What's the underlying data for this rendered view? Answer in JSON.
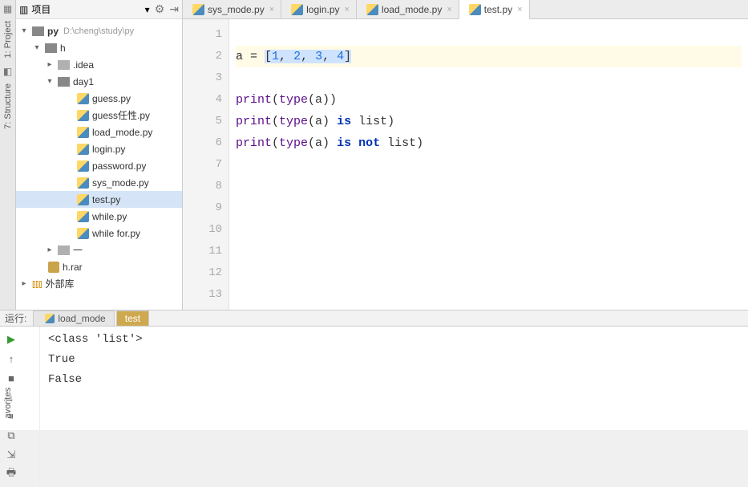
{
  "side_tabs": {
    "project": "1: Project",
    "structure": "7: Structure",
    "favorites": "avorites"
  },
  "project_panel": {
    "header": {
      "title": "项目"
    },
    "root": {
      "name": "py",
      "path": "D:\\cheng\\study\\py"
    },
    "h_folder": "h",
    "idea_folder": ".idea",
    "day1_folder": "day1",
    "files": {
      "guess": "guess.py",
      "guess2": "guess任性.py",
      "load_mode": "load_mode.py",
      "login": "login.py",
      "password": "password.py",
      "sys_mode": "sys_mode.py",
      "test": "test.py",
      "while": "while.py",
      "while_for": "while for.py"
    },
    "dash_folder": "一",
    "hrar": "h.rar",
    "external": "外部库"
  },
  "tabs": {
    "sys_mode": "sys_mode.py",
    "login": "login.py",
    "load_mode": "load_mode.py",
    "test": "test.py"
  },
  "code": {
    "line2a": "a = ",
    "line2b": "[",
    "line2v1": "1",
    "line2v2": "2",
    "line2v3": "3",
    "line2v4": "4",
    "line2c": "]",
    "sep": ", ",
    "line4_print": "print",
    "line4_type": "type",
    "line4_a": "(a))",
    "line5_a": "(a) ",
    "line5_is": "is",
    "line5_list": " list)",
    "line6_is": "is",
    "line6_not": "not",
    "line6_list": " list)"
  },
  "gutter": [
    "1",
    "2",
    "3",
    "4",
    "5",
    "6",
    "7",
    "8",
    "9",
    "10",
    "11",
    "12",
    "13"
  ],
  "run": {
    "label": "运行:",
    "tab_load": "load_mode",
    "tab_test": "test",
    "out1": "<class 'list'>",
    "out2": "True",
    "out3": "False"
  }
}
